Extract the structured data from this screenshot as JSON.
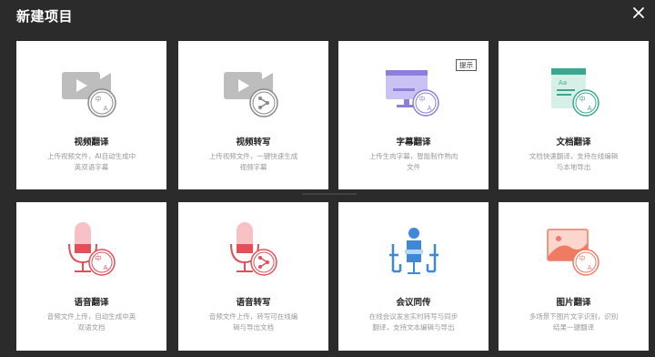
{
  "title": "新建项目",
  "tip": "提示",
  "cards": [
    {
      "name": "视频翻译",
      "desc": "上传视频文件，AI自动生成中英双语字幕",
      "icon": "video-translate-icon"
    },
    {
      "name": "视频转写",
      "desc": "上传视频文件，一键快速生成视频字幕",
      "icon": "video-transcribe-icon"
    },
    {
      "name": "字幕翻译",
      "desc": "上传生肉字幕，智能制作熟肉文件",
      "icon": "subtitle-translate-icon"
    },
    {
      "name": "文档翻译",
      "desc": "文档快速翻译，支持在线编辑与本地导出",
      "icon": "document-translate-icon"
    },
    {
      "name": "语音翻译",
      "desc": "音频文件上传，自动生成中英双语文档",
      "icon": "voice-translate-icon"
    },
    {
      "name": "语音转写",
      "desc": "音频文件上传，转写可在线编辑与导出文档",
      "icon": "voice-transcribe-icon"
    },
    {
      "name": "会议同传",
      "desc": "在线会议发言实时转写与同步翻译，支持文本编辑与导出",
      "icon": "meeting-interpret-icon"
    },
    {
      "name": "图片翻译",
      "desc": "多场景下图片文字识别，识别结果一键翻译",
      "icon": "image-translate-icon"
    }
  ],
  "colors": {
    "video": "#8a8a8a",
    "subtitle": "#8b7fd9",
    "document": "#3aa88f",
    "voice": "#e24f58",
    "meeting": "#3f87d9",
    "image": "#ef7b62"
  }
}
